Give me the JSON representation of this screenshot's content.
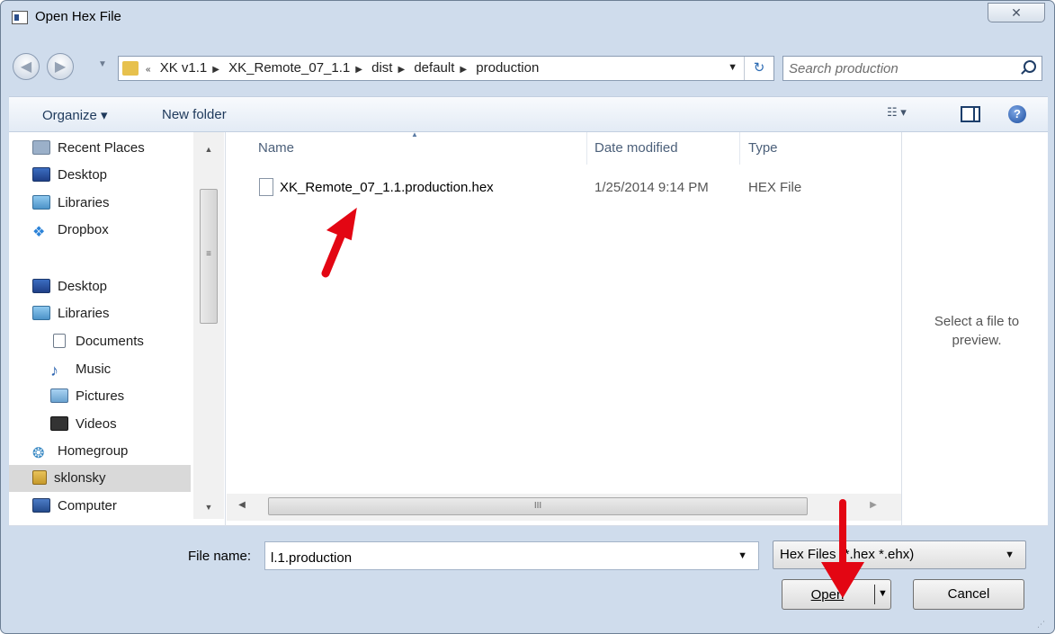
{
  "window": {
    "title": "Open Hex File",
    "close_label": "✕"
  },
  "address": {
    "crumbs": [
      "XK v1.1",
      "XK_Remote_07_1.1",
      "dist",
      "default",
      "production"
    ]
  },
  "search": {
    "placeholder": "Search production"
  },
  "toolbar": {
    "organize_label": "Organize ▾",
    "new_folder_label": "New folder"
  },
  "sidebar": {
    "items": [
      {
        "label": "Recent Places",
        "icon": "recent-places-icon"
      },
      {
        "label": "Desktop",
        "icon": "desktop-icon"
      },
      {
        "label": "Libraries",
        "icon": "libraries-icon"
      },
      {
        "label": "Dropbox",
        "icon": "dropbox-icon"
      },
      {
        "label": "Desktop",
        "icon": "desktop-icon"
      },
      {
        "label": "Libraries",
        "icon": "libraries-icon"
      },
      {
        "label": "Documents",
        "icon": "documents-icon"
      },
      {
        "label": "Music",
        "icon": "music-icon"
      },
      {
        "label": "Pictures",
        "icon": "pictures-icon"
      },
      {
        "label": "Videos",
        "icon": "videos-icon"
      },
      {
        "label": "Homegroup",
        "icon": "homegroup-icon"
      },
      {
        "label": "sklonsky",
        "icon": "user-folder-icon"
      },
      {
        "label": "Computer",
        "icon": "computer-icon"
      }
    ]
  },
  "file_list": {
    "columns": [
      "Name",
      "Date modified",
      "Type"
    ],
    "rows": [
      {
        "name": "XK_Remote_07_1.1.production.hex",
        "date": "1/25/2014 9:14 PM",
        "type": "HEX File"
      }
    ]
  },
  "preview": {
    "text": "Select a file to preview."
  },
  "bottom": {
    "file_name_label": "File name:",
    "file_name_value": "l.1.production",
    "file_type_value": "Hex Files (*.hex *.ehx)",
    "open_label": "Open",
    "cancel_label": "Cancel"
  },
  "colors": {
    "annotation_arrow": "#e30613",
    "window_frame": "#cfdcec"
  }
}
